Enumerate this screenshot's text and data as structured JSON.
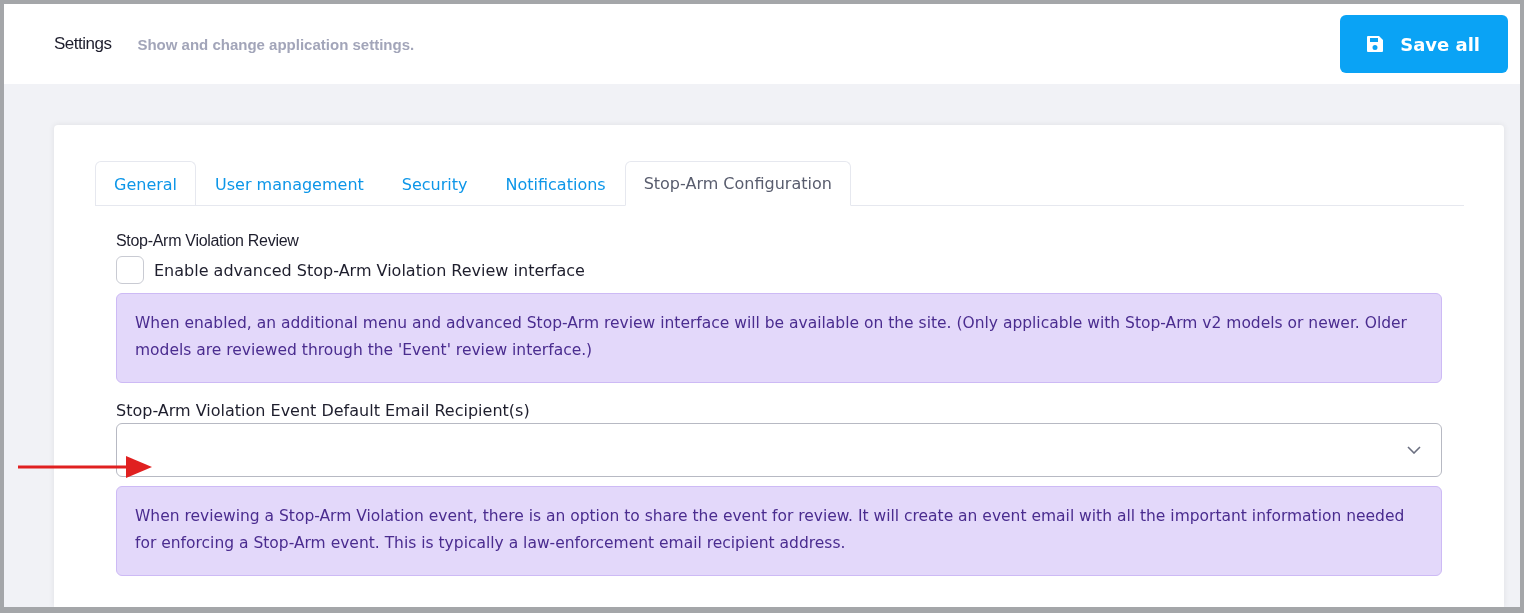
{
  "header": {
    "title": "Settings",
    "subtitle": "Show and change application settings.",
    "save_button": "Save all"
  },
  "tabs": [
    {
      "label": "General",
      "selected": false
    },
    {
      "label": "User management",
      "selected": false
    },
    {
      "label": "Security",
      "selected": false
    },
    {
      "label": "Notifications",
      "selected": false
    },
    {
      "label": "Stop-Arm Configuration",
      "selected": true
    }
  ],
  "section_title": "Stop-Arm Violation Review",
  "checkbox": {
    "label": "Enable advanced Stop-Arm Violation Review interface",
    "checked": false
  },
  "info_1": "When enabled, an additional menu and advanced Stop-Arm review interface will be available on the site. (Only applicable with Stop-Arm v2 models or newer. Older models are reviewed through the 'Event' review interface.)",
  "recipients": {
    "label": "Stop-Arm Violation Event Default Email Recipient(s)"
  },
  "info_2": "When reviewing a Stop-Arm Violation event, there is an option to share the event for review. It will create an event email with all the important information needed for enforcing a Stop-Arm event. This is typically a law-enforcement email recipient address."
}
